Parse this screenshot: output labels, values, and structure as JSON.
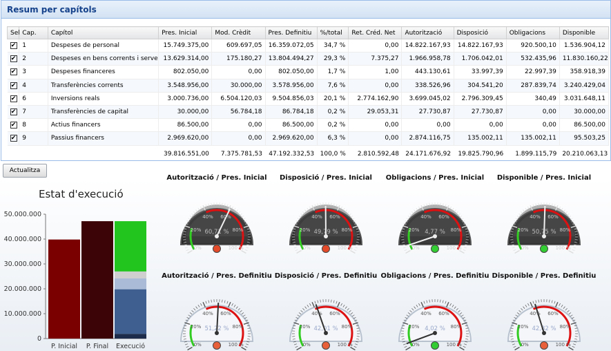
{
  "panel": {
    "title": "Resum per capítols"
  },
  "grid": {
    "columns": [
      "Sel",
      "Cap.",
      "Capítol",
      "Pres. Inicial",
      "Mod. Crèdit",
      "Pres. Definitiu",
      "%/total",
      "Ret. Créd. Net",
      "Autorització",
      "Disposició",
      "Obligacions",
      "Disponible"
    ],
    "rows": [
      {
        "sel": "✔",
        "cap": "1",
        "capitol": "Despeses de personal",
        "pres_inicial": "15.749.375,00",
        "mod": "609.697,05",
        "def": "16.359.072,05",
        "pct": "34,7 %",
        "ret": "0,00",
        "aut": "14.822.167,93",
        "disp": "14.822.167,93",
        "obl": "920.500,10",
        "dispon": "1.536.904,12"
      },
      {
        "sel": "✔",
        "cap": "2",
        "capitol": "Despeses en bens corrents i serveis",
        "pres_inicial": "13.629.314,00",
        "mod": "175.180,27",
        "def": "13.804.494,27",
        "pct": "29,3 %",
        "ret": "7.375,27",
        "aut": "1.966.958,78",
        "disp": "1.706.042,01",
        "obl": "532.435,96",
        "dispon": "11.830.160,22"
      },
      {
        "sel": "✔",
        "cap": "3",
        "capitol": "Despeses financeres",
        "pres_inicial": "802.050,00",
        "mod": "0,00",
        "def": "802.050,00",
        "pct": "1,7 %",
        "ret": "1,00",
        "aut": "443.130,61",
        "disp": "33.997,39",
        "obl": "22.997,39",
        "dispon": "358.918,39"
      },
      {
        "sel": "✔",
        "cap": "4",
        "capitol": "Transferències corrents",
        "pres_inicial": "3.548.956,00",
        "mod": "30.000,00",
        "def": "3.578.956,00",
        "pct": "7,6 %",
        "ret": "0,00",
        "aut": "338.526,96",
        "disp": "304.541,20",
        "obl": "287.839,74",
        "dispon": "3.240.429,04"
      },
      {
        "sel": "✔",
        "cap": "6",
        "capitol": "Inversions reals",
        "pres_inicial": "3.000.736,00",
        "mod": "6.504.120,03",
        "def": "9.504.856,03",
        "pct": "20,1 %",
        "ret": "2.774.162,90",
        "aut": "3.699.045,02",
        "disp": "2.796.309,45",
        "obl": "340,49",
        "dispon": "3.031.648,11"
      },
      {
        "sel": "✔",
        "cap": "7",
        "capitol": "Transferències de capital",
        "pres_inicial": "30.000,00",
        "mod": "56.784,18",
        "def": "86.784,18",
        "pct": "0,2 %",
        "ret": "29.053,31",
        "aut": "27.730,87",
        "disp": "27.730,87",
        "obl": "0,00",
        "dispon": "30.000,00"
      },
      {
        "sel": "✔",
        "cap": "8",
        "capitol": "Actius financers",
        "pres_inicial": "86.500,00",
        "mod": "0,00",
        "def": "86.500,00",
        "pct": "0,2 %",
        "ret": "0,00",
        "aut": "0,00",
        "disp": "0,00",
        "obl": "0,00",
        "dispon": "86.500,00"
      },
      {
        "sel": "✔",
        "cap": "9",
        "capitol": "Passius financers",
        "pres_inicial": "2.969.620,00",
        "mod": "0,00",
        "def": "2.969.620,00",
        "pct": "6,3 %",
        "ret": "0,00",
        "aut": "2.874.116,75",
        "disp": "135.002,11",
        "obl": "135.002,11",
        "dispon": "95.503,25"
      }
    ],
    "totals": {
      "pres_inicial": "39.816.551,00",
      "mod": "7.375.781,53",
      "def": "47.192.332,53",
      "pct": "100,0 %",
      "ret": "2.810.592,48",
      "aut": "24.171.676,92",
      "disp": "19.825.790,96",
      "obl": "1.899.115,79",
      "dispon": "20.210.063,13"
    }
  },
  "refresh_button": "Actualitza",
  "chart_data": {
    "type": "bar",
    "title": "Estat d'execució",
    "categories": [
      "P. Inicial",
      "P. Final",
      "Execució"
    ],
    "yticks": [
      "0",
      "10.000.000",
      "20.000.000",
      "30.000.000",
      "40.000.000",
      "50.000.000"
    ],
    "ylim": [
      0,
      50000000
    ],
    "bars": [
      {
        "category": "P. Inicial",
        "segments": [
          {
            "value": 39816551,
            "color": "#7a0000"
          }
        ]
      },
      {
        "category": "P. Final",
        "segments": [
          {
            "value": 47192332,
            "color": "#3d0408"
          }
        ]
      },
      {
        "category": "Execució",
        "segments": [
          {
            "value": 1899116,
            "color": "#1c2c4a"
          },
          {
            "value": 17926675,
            "color": "#3e5f8f"
          },
          {
            "value": 4345886,
            "color": "#a9bbd6"
          },
          {
            "value": 2810592,
            "color": "#cfcfcf"
          },
          {
            "value": 20210063,
            "color": "#22c41e"
          }
        ]
      }
    ]
  },
  "gauges_top": [
    {
      "title": "Autorització / Pres. Inicial",
      "value": 60.71,
      "label": "60,71 %"
    },
    {
      "title": "Disposició / Pres. Inicial",
      "value": 49.79,
      "label": "49,79 %"
    },
    {
      "title": "Obligacions / Pres. Inicial",
      "value": 4.77,
      "label": "4,77 %"
    },
    {
      "title": "Disponible / Pres. Inicial",
      "value": 50.75,
      "label": "50,75 %"
    }
  ],
  "gauges_bottom": [
    {
      "title": "Autorització / Pres. Definitiu",
      "value": 51.22,
      "label": "51,22 %"
    },
    {
      "title": "Disposició / Pres. Definitiu",
      "value": 42.01,
      "label": "42,01 %"
    },
    {
      "title": "Obligacions / Pres. Definitiu",
      "value": 4.02,
      "label": "4,02 %"
    },
    {
      "title": "Disponible / Pres. Definitiu",
      "value": 42.82,
      "label": "42,82 %"
    }
  ],
  "gauge_ticks": [
    "0%",
    "20%",
    "40%",
    "60%",
    "80%",
    "100 %"
  ]
}
